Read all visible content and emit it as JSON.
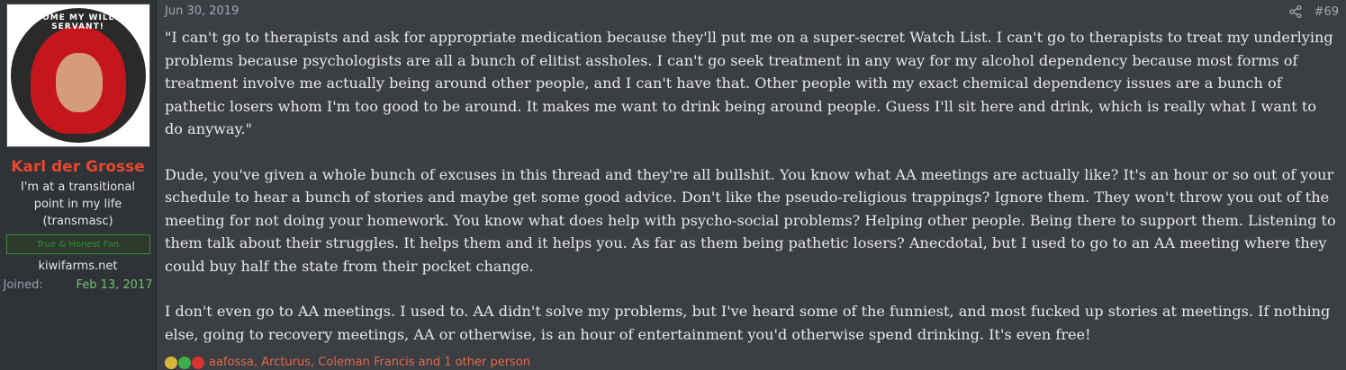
{
  "user": {
    "name": "Karl der Grosse",
    "avatar_text": "BECOME MY WILLING SERVANT!",
    "title": "I'm at a transitional point in my life (transmasc)",
    "banner": "True & Honest Fan",
    "site": "kiwifarms.net",
    "joined_label": "Joined:",
    "joined_value": "Feb 13, 2017"
  },
  "post": {
    "date": "Jun 30, 2019",
    "number": "#69",
    "paragraphs": [
      "\"I can't go to therapists and ask for appropriate medication because they'll put me on a super-secret Watch List. I can't go to therapists to treat my underlying problems because psychologists are all a bunch of elitist assholes. I can't go seek treatment in any way for my alcohol dependency because most forms of treatment involve me actually being around other people, and I can't have that. Other people with my exact chemical dependency issues are a bunch of pathetic losers whom I'm too good to be around. It makes me want to drink being around people. Guess I'll sit here and drink, which is really what I want to do anyway.\"",
      "Dude, you've given a whole bunch of excuses in this thread and they're all bullshit. You know what AA meetings are actually like? It's an hour or so out of your schedule to hear a bunch of stories and maybe get some good advice. Don't like the pseudo-religious trappings? Ignore them. They won't throw you out of the meeting for not doing your homework. You know what does help with psycho-social problems? Helping other people. Being there to support them. Listening to them talk about their struggles. It helps them and it helps you. As far as them being pathetic losers? Anecdotal, but I used to go to an AA meeting where they could buy half the state from their pocket change.",
      "I don't even go to AA meetings. I used to. AA didn't solve my problems, but I've heard some of the funniest, and most fucked up stories at meetings. If nothing else, going to recovery meetings, AA or otherwise, is an hour of entertainment you'd otherwise spend drinking. It's even free!"
    ],
    "reactions": {
      "icons": [
        "pineapple-icon",
        "check-icon",
        "heart-icon"
      ],
      "colors": [
        "#d7b53a",
        "#3fae4a",
        "#d8332f"
      ],
      "text": "aafossa, Arcturus, Coleman Francis and 1 other person"
    }
  }
}
